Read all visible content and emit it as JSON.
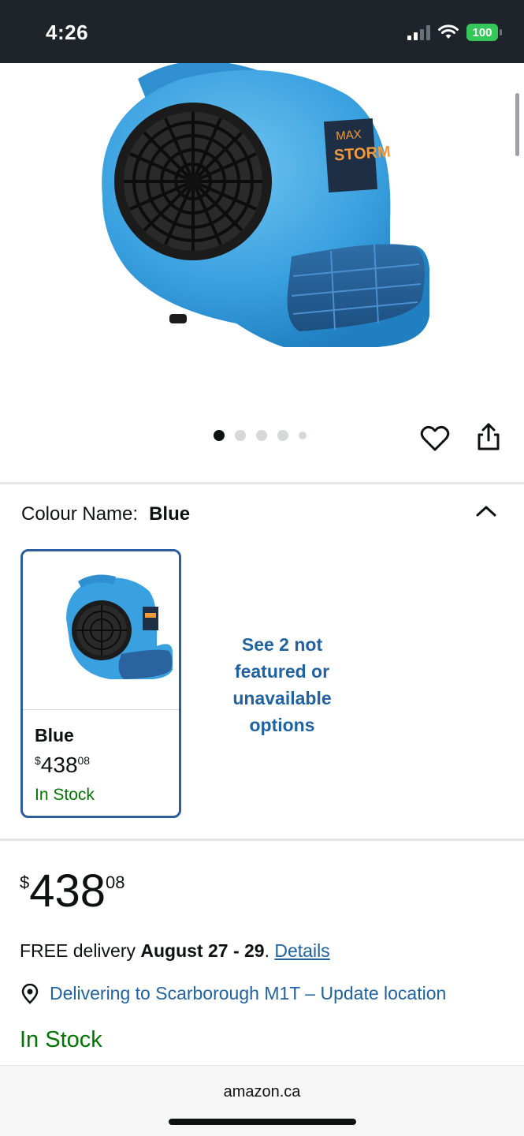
{
  "status_bar": {
    "time": "4:26",
    "battery": "100"
  },
  "product": {
    "image_label": "blue air mover fan",
    "brand_text_1": "MAX",
    "brand_text_2": "STORM",
    "carousel": {
      "count": 5,
      "active_index": 0
    }
  },
  "colour": {
    "label": "Colour Name:",
    "value": "Blue",
    "swatch": {
      "name": "Blue",
      "price_symbol": "$",
      "price_whole": "438",
      "price_fraction": "08",
      "stock": "In Stock"
    },
    "see_more": "See 2 not featured or unavailable options"
  },
  "price": {
    "symbol": "$",
    "whole": "438",
    "fraction": "08"
  },
  "delivery": {
    "prefix": "FREE delivery ",
    "dates": "August 27 - 29",
    "suffix": ". ",
    "details_link": "Details"
  },
  "location": {
    "text": "Delivering to Scarborough M1T – Update location"
  },
  "availability": "In Stock",
  "browser": {
    "domain": "amazon.ca"
  },
  "colors": {
    "accent_blue": "#2162a1",
    "stock_green": "#007600",
    "swatch_border": "#2e5d9e",
    "product_blue": "#3aa1e0"
  }
}
